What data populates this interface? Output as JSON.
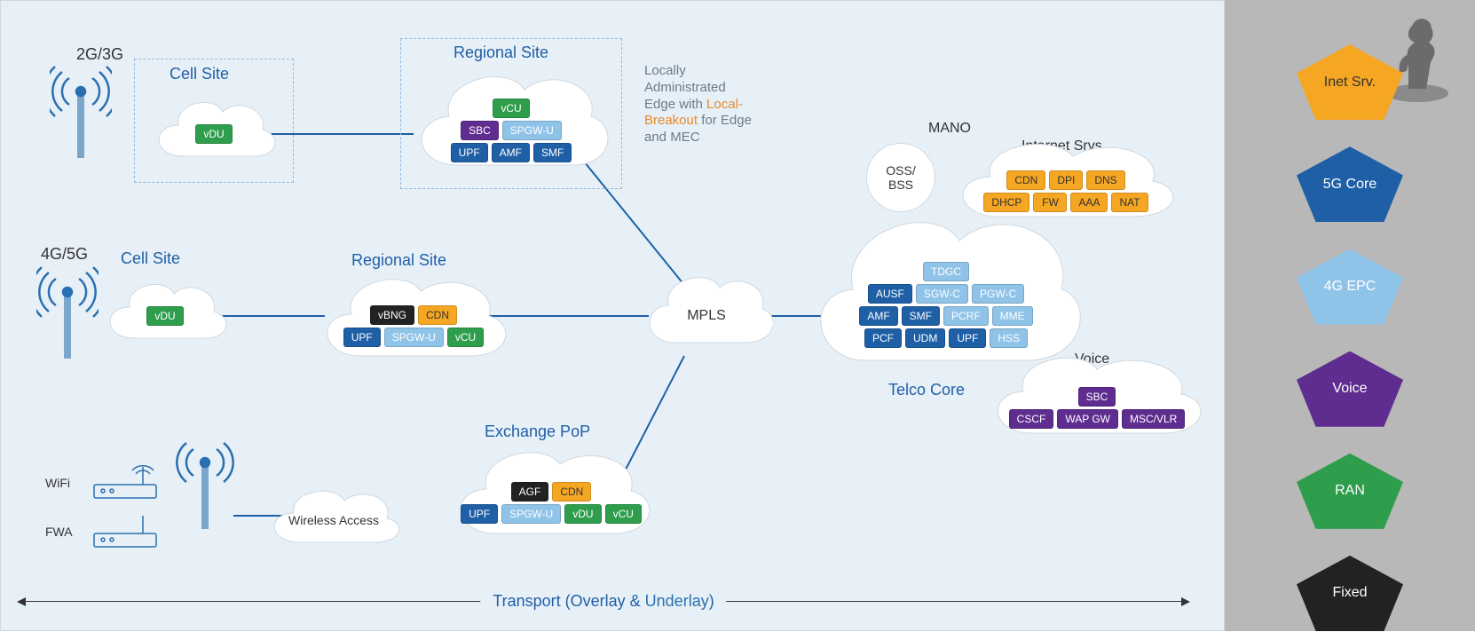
{
  "access": {
    "gen23": "2G/3G",
    "gen45": "4G/5G",
    "wifi": "WiFi",
    "fwa": "FWA"
  },
  "cell_site_title": "Cell Site",
  "cell_site_chip": "vDU",
  "regional_site_title": "Regional Site",
  "regional_top": {
    "row1": [
      "vCU"
    ],
    "row2": [
      "SBC",
      "SPGW-U"
    ],
    "row3": [
      "UPF",
      "AMF",
      "SMF"
    ]
  },
  "regional_mid": {
    "row1": [
      "vBNG",
      "CDN"
    ],
    "row2": [
      "UPF",
      "SPGW-U",
      "vCU"
    ]
  },
  "exchange_title": "Exchange PoP",
  "exchange": {
    "row1": [
      "AGF",
      "CDN"
    ],
    "row2": [
      "UPF",
      "SPGW-U",
      "vDU",
      "vCU"
    ]
  },
  "wireless_access": "Wireless Access",
  "mpls": "MPLS",
  "mano": "MANO",
  "ossbss": "OSS/\nBSS",
  "internet_srvs_title": "Internet Srvs",
  "internet_srvs": {
    "row1": [
      "CDN",
      "DPI",
      "DNS"
    ],
    "row2": [
      "DHCP",
      "FW",
      "AAA",
      "NAT"
    ]
  },
  "telco_core_title": "Telco Core",
  "telco_core": {
    "row1": [
      "TDGC"
    ],
    "row2": [
      "AUSF",
      "SGW-C",
      "PGW-C"
    ],
    "row3": [
      "AMF",
      "SMF",
      "PCRF",
      "MME"
    ],
    "row4": [
      "PCF",
      "UDM",
      "UPF",
      "HSS"
    ]
  },
  "voice_title": "Voice",
  "voice": {
    "row1": [
      "SBC"
    ],
    "row2": [
      "CSCF",
      "WAP GW",
      "MSC/VLR"
    ]
  },
  "edge_note": {
    "l1": "Locally",
    "l2": "Administrated",
    "l3a": "Edge with ",
    "l3b": "Local-",
    "l4a": "Breakout",
    "l4b": " for Edge",
    "l5": "and MEC"
  },
  "transport": {
    "pre": "Transport (",
    "ov": "Overlay",
    "amp": " & ",
    "ud": "Underlay",
    "post": ")"
  },
  "legend": {
    "inet": "Inet Srv.",
    "core5g": "5G Core",
    "epc4g": "4G EPC",
    "voice": "Voice",
    "ran": "RAN",
    "fixed": "Fixed"
  }
}
